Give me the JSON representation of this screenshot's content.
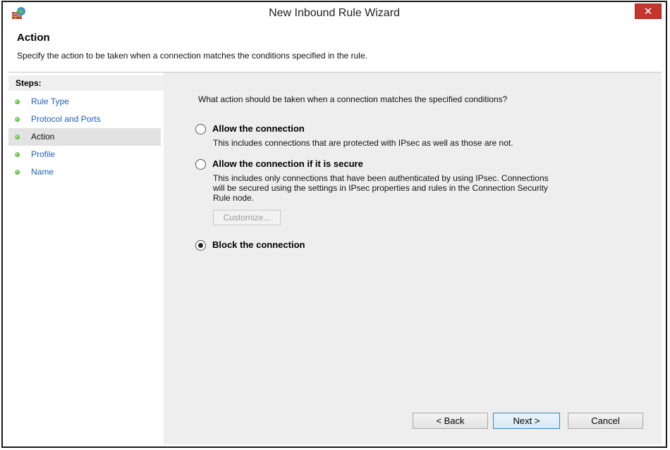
{
  "window": {
    "title": "New Inbound Rule Wizard",
    "close_glyph": "✕",
    "app_icon": "firewall-icon",
    "close_color": "#c7342d"
  },
  "header": {
    "title": "Action",
    "description": "Specify the action to be taken when a connection matches the conditions specified in the rule."
  },
  "steps": {
    "heading": "Steps:",
    "items": [
      {
        "label": "Rule Type",
        "current": false
      },
      {
        "label": "Protocol and Ports",
        "current": false
      },
      {
        "label": "Action",
        "current": true
      },
      {
        "label": "Profile",
        "current": false
      },
      {
        "label": "Name",
        "current": false
      }
    ],
    "link_color": "#1e5fbf",
    "dot_color": "#2f9a1a"
  },
  "main": {
    "question": "What action should be taken when a connection matches the specified conditions?",
    "options": [
      {
        "label": "Allow the connection",
        "description": "This includes connections that are protected with IPsec as well as those are not.",
        "selected": false
      },
      {
        "label": "Allow the connection if it is secure",
        "description_lines": [
          "This includes only connections that have been authenticated by using IPsec.  Connections",
          "will be secured using the settings in IPsec properties and rules in the Connection Security",
          "Rule node."
        ],
        "selected": false
      },
      {
        "label": "Block the connection",
        "selected": true
      }
    ],
    "customize_label": "Customize..."
  },
  "footer": {
    "back_label": "< Back",
    "next_label": "Next >",
    "cancel_label": "Cancel"
  }
}
